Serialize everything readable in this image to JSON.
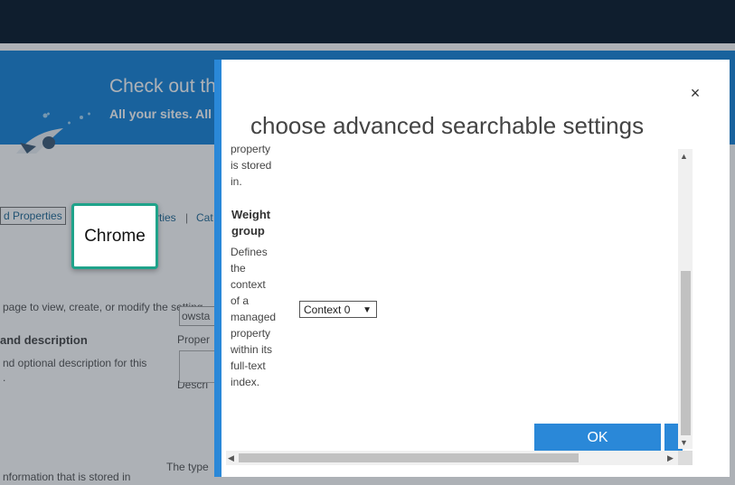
{
  "background": {
    "banner_title": "Check out th",
    "banner_subtitle": "All your sites. All",
    "tab_label": "d Properties",
    "link1": "rties",
    "link_sep": "|",
    "link2": "Cat",
    "intro": "page to view, create, or modify the setting",
    "section_heading": "and description",
    "section_desc_1": "nd optional description for this",
    "section_desc_2": ".",
    "prop_label": "Proper",
    "prop_value": "owsta",
    "desc_label": "Descri",
    "info_text": "nformation that is stored in",
    "type_label": "The type"
  },
  "badge": {
    "label": "Chrome"
  },
  "dialog": {
    "title": "choose advanced searchable settings",
    "close_label": "×",
    "fragment_lines": [
      "property",
      "is stored",
      "in."
    ],
    "weight_group": {
      "heading_lines": [
        "Weight",
        "group"
      ],
      "desc_lines": [
        "Defines",
        "the",
        "context",
        "of a",
        "managed",
        "property",
        "within its",
        "full-text",
        "index."
      ]
    },
    "select": {
      "value": "Context 0"
    },
    "ok_label": "OK"
  },
  "colors": {
    "accent": "#2a88d8",
    "topbar": "#0f1e2e",
    "badge_border": "#1fa38a"
  },
  "icons": [
    "close-icon",
    "rocket-icon",
    "dropdown-arrow-icon",
    "scroll-up-icon",
    "scroll-down-icon",
    "scroll-left-icon",
    "scroll-right-icon"
  ]
}
